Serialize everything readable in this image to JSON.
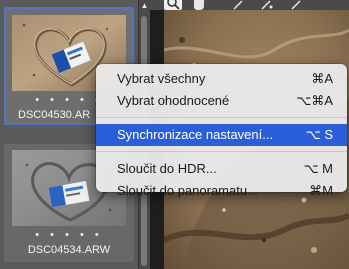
{
  "filmstrip": {
    "thumbnails": [
      {
        "filename": "DSC04530.AR",
        "dots": "• • • • •",
        "selected": true
      },
      {
        "filename": "DSC04534.ARW",
        "dots": "• • • • •",
        "selected": false
      }
    ]
  },
  "toolbar": {
    "tools": [
      "zoom-icon",
      "hand-icon",
      "eyedropper-icon",
      "color-sampler-icon",
      "target-adjustment-icon"
    ]
  },
  "context_menu": {
    "items": [
      {
        "label": "Vybrat všechny",
        "shortcut": "⌘A"
      },
      {
        "label": "Vybrat ohodnocené",
        "shortcut": "⌥⌘A"
      },
      {
        "label": "Synchronizace nastavení...",
        "shortcut": "⌥ S",
        "highlighted": true
      },
      {
        "label": "Sloučit do HDR...",
        "shortcut": "⌥ M"
      },
      {
        "label": "Sloučit do panoramatu...",
        "shortcut": "⌘M"
      }
    ]
  },
  "colors": {
    "highlight": "#2b5fd9",
    "selection_border": "#4d76c7",
    "menu_background": "#e8e8e8"
  }
}
